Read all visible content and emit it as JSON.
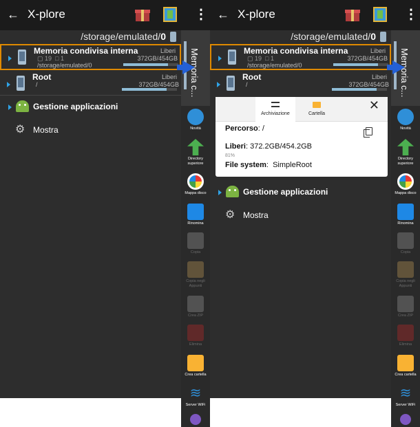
{
  "app": {
    "title": "X-plore"
  },
  "path": {
    "prefix": "/storage/emulated/",
    "last": "0"
  },
  "storage": {
    "name": "Memoria condivisa interna",
    "folders": "19",
    "files": "1",
    "path": "/storage/emulated/0",
    "free_label": "Liberi",
    "size": "372GB/454GB",
    "used_fraction": 0.81
  },
  "root": {
    "name": "Root",
    "path": "/",
    "free_label": "Liberi",
    "size": "372GB/454GB",
    "used_fraction": 0.81
  },
  "apps": {
    "label": "Gestione applicazioni"
  },
  "show": {
    "label": "Mostra"
  },
  "side_tab": {
    "label": "Memoria c..."
  },
  "toolbar": {
    "news": "Novità",
    "parent_dir": "Directory superiore",
    "disk_map": "Mappa disco",
    "rename": "Rinomina",
    "copy": "Copia",
    "copy_clip": "Copia negli Appunti",
    "create_zip": "Crea ZIP",
    "delete": "Elimina",
    "create_folder": "Crea cartella",
    "wifi_server": "Server WiFi"
  },
  "popup": {
    "tab_storage": "Archiviazione",
    "tab_folder": "Cartella",
    "path_label": "Percorso",
    "path_value": "/",
    "free_label": "Liberi",
    "free_value": "372.2GB/454.2GB",
    "percent": "81%",
    "fs_label": "File system",
    "fs_value": "SimpleRoot"
  },
  "colors": {
    "accent": "#e08a00",
    "arrow": "#2460d6",
    "triangle": "#2fa3e6"
  }
}
